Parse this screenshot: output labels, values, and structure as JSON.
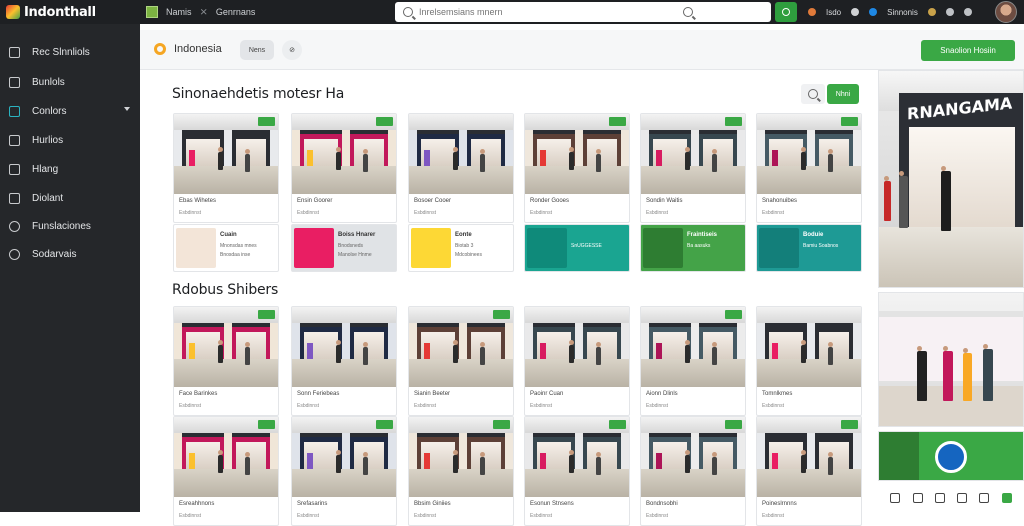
{
  "app": {
    "name": "Indonthall"
  },
  "topbar": {
    "nav": [
      "Namis",
      "Genrnans"
    ],
    "search_placeholder": "Inrelsemsians mnern",
    "right_items": [
      "Isdo",
      "Sinnonis"
    ]
  },
  "sidebar": {
    "items": [
      {
        "label": "Rec Slnnliols",
        "icon": "grid-icon"
      },
      {
        "label": "Bunlols",
        "icon": "bag-icon"
      },
      {
        "label": "Conlors",
        "icon": "store-icon",
        "active": true,
        "expandable": true
      },
      {
        "label": "Hurlios",
        "icon": "tag-icon"
      },
      {
        "label": "Hlang",
        "icon": "cart-icon"
      },
      {
        "label": "Diolant",
        "icon": "doc-icon"
      },
      {
        "label": "Funslaciones",
        "icon": "settings-icon"
      },
      {
        "label": "Sodarvais",
        "icon": "globe-icon"
      }
    ]
  },
  "header": {
    "title": "Indonesia",
    "chip_label": "Nens",
    "cta_label": "Snaolion Hosiin"
  },
  "section1": {
    "title": "Sinonaehdetis motesr Ha",
    "button_label": "Nhni",
    "cards": [
      {
        "caption": "Ebas Wihetes",
        "sub": "Esbdinnst"
      },
      {
        "caption": "Ensin Goorer",
        "sub": "Esbdinnst"
      },
      {
        "caption": "Bosoer Cooer",
        "sub": "Esbdinnst"
      },
      {
        "caption": "Ronder Gooes",
        "sub": "Esbdinnst"
      },
      {
        "caption": "Sondin Waitis",
        "sub": "Esbdinnst"
      },
      {
        "caption": "Snahonuibes",
        "sub": "Esbdinnst"
      }
    ],
    "promos": [
      {
        "t1": "Cuain",
        "t2": "Mnonsdas mnes",
        "t3": "Bnosdaa inse",
        "color": "#ffffff"
      },
      {
        "t1": "Boiss Hnarer",
        "t2": "Bnodsneds",
        "t3": "Manolse Hnme",
        "color": "#e0e3e6"
      },
      {
        "t1": "Eonte",
        "t2": "Biotab 3",
        "t3": "Mdcobinees",
        "color": "#ffffff"
      },
      {
        "t1": "",
        "t2": "SnUGGESSE",
        "t3": "",
        "color": "#1aa591"
      },
      {
        "t1": "Fraintiseis",
        "t2": "Ba aasuks",
        "t3": "",
        "color": "#44a348"
      },
      {
        "t1": "Boduie",
        "t2": "Bamiu Soabnos",
        "t3": "",
        "color": "#1e9a95"
      }
    ]
  },
  "section2": {
    "title": "Rdobus Shibers",
    "cards": [
      {
        "caption": "Face Barinkes",
        "sub": "Esbdinnst"
      },
      {
        "caption": "Sonn Feriebeas",
        "sub": "Esbdinnst"
      },
      {
        "caption": "Sianin Beeter",
        "sub": "Esbdinnst"
      },
      {
        "caption": "Paoinr Cuan",
        "sub": "Esbdinnst"
      },
      {
        "caption": "Aionn Dlinls",
        "sub": "Esbdinnst"
      },
      {
        "caption": "Tomnlkmes",
        "sub": "Esbdinnst"
      },
      {
        "caption": "Esreahhnons",
        "sub": "Esbdinnst"
      },
      {
        "caption": "Srefasarins",
        "sub": "Esbdinnst"
      },
      {
        "caption": "Bbsim Giniies",
        "sub": "Esbdinnst"
      },
      {
        "caption": "Esonun Stnsens",
        "sub": "Esbdinnst"
      },
      {
        "caption": "Bondnsobhi",
        "sub": "Esbdinnst"
      },
      {
        "caption": "Poineslrnnns",
        "sub": "Esbdinnst"
      }
    ]
  },
  "right_panel": {
    "store_sign": "RNANGAMA"
  },
  "colors": {
    "accent": "#3aa845",
    "sidebar": "#25272a",
    "topbar": "#1e2023",
    "teal": "#2bb3c0"
  }
}
